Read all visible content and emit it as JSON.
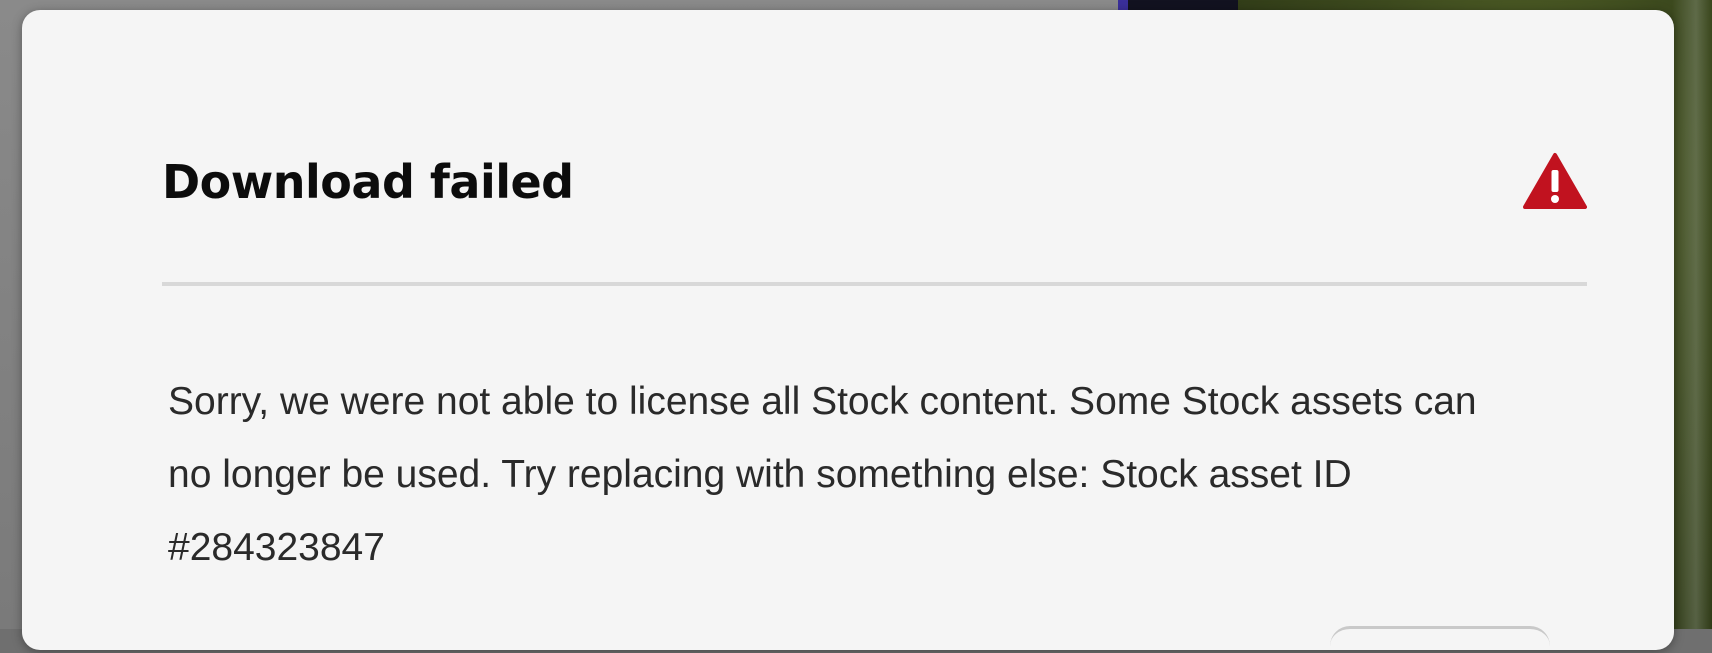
{
  "dialog": {
    "title": "Download failed",
    "status_icon": "warning-triangle-icon",
    "message": "Sorry, we were not able to license all Stock content. Some Stock assets can no longer be used. Try replacing with something else: Stock asset ID #284323847"
  },
  "colors": {
    "dialog_background": "#f5f5f5",
    "title_text": "#0c0c0c",
    "body_text": "#2a2a2a",
    "warning_red": "#c1121f",
    "divider": "#d8d8d8"
  }
}
